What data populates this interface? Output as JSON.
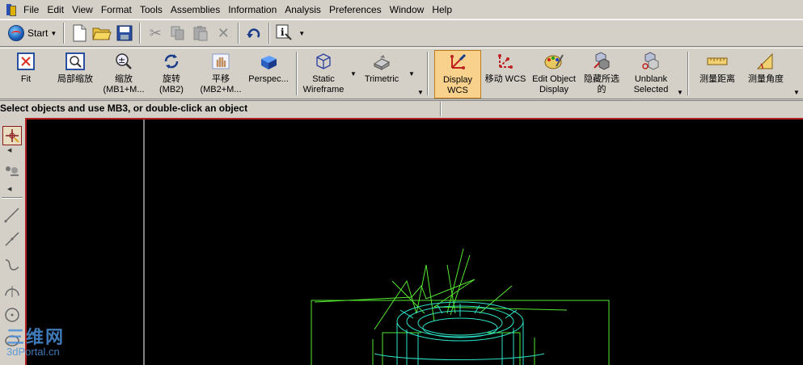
{
  "menu": [
    "File",
    "Edit",
    "View",
    "Format",
    "Tools",
    "Assemblies",
    "Information",
    "Analysis",
    "Preferences",
    "Window",
    "Help"
  ],
  "toolbar_std": {
    "start_label": "Start"
  },
  "view_tools": [
    {
      "label": "Fit",
      "icon": "fit-icon"
    },
    {
      "label": "局部缩放",
      "icon": "zoom-region-icon"
    },
    {
      "label": "缩放\n(MB1+M...",
      "icon": "zoom-icon"
    },
    {
      "label": "旋转\n(MB2)",
      "icon": "rotate-icon"
    },
    {
      "label": "平移\n(MB2+M...",
      "icon": "pan-icon"
    },
    {
      "label": "Perspec...",
      "icon": "perspective-icon"
    },
    {
      "label": "Static\nWireframe",
      "icon": "wireframe-icon"
    },
    {
      "label": "Trimetric",
      "icon": "trimetric-icon"
    },
    {
      "label": "Display\nWCS",
      "icon": "display-wcs-icon"
    },
    {
      "label": "移动 WCS",
      "icon": "move-wcs-icon"
    },
    {
      "label": "Edit Object\nDisplay",
      "icon": "edit-object-display-icon"
    },
    {
      "label": "隐藏所选\n的",
      "icon": "blank-selected-icon"
    },
    {
      "label": "Unblank\nSelected",
      "icon": "unblank-selected-icon"
    },
    {
      "label": "测量距离",
      "icon": "measure-distance-icon"
    },
    {
      "label": "测量角度",
      "icon": "measure-angle-icon"
    }
  ],
  "status": {
    "prompt": "Select objects and use MB3, or double-click an object"
  },
  "watermark": {
    "big": "三维网",
    "small": "3dPortal.cn"
  },
  "colors": {
    "wire_green": "#55e830",
    "wire_cyan": "#2de3c8",
    "viewport_bg": "#000000",
    "viewport_border": "#b02020",
    "active_tool_bg": "#f8d28c"
  }
}
